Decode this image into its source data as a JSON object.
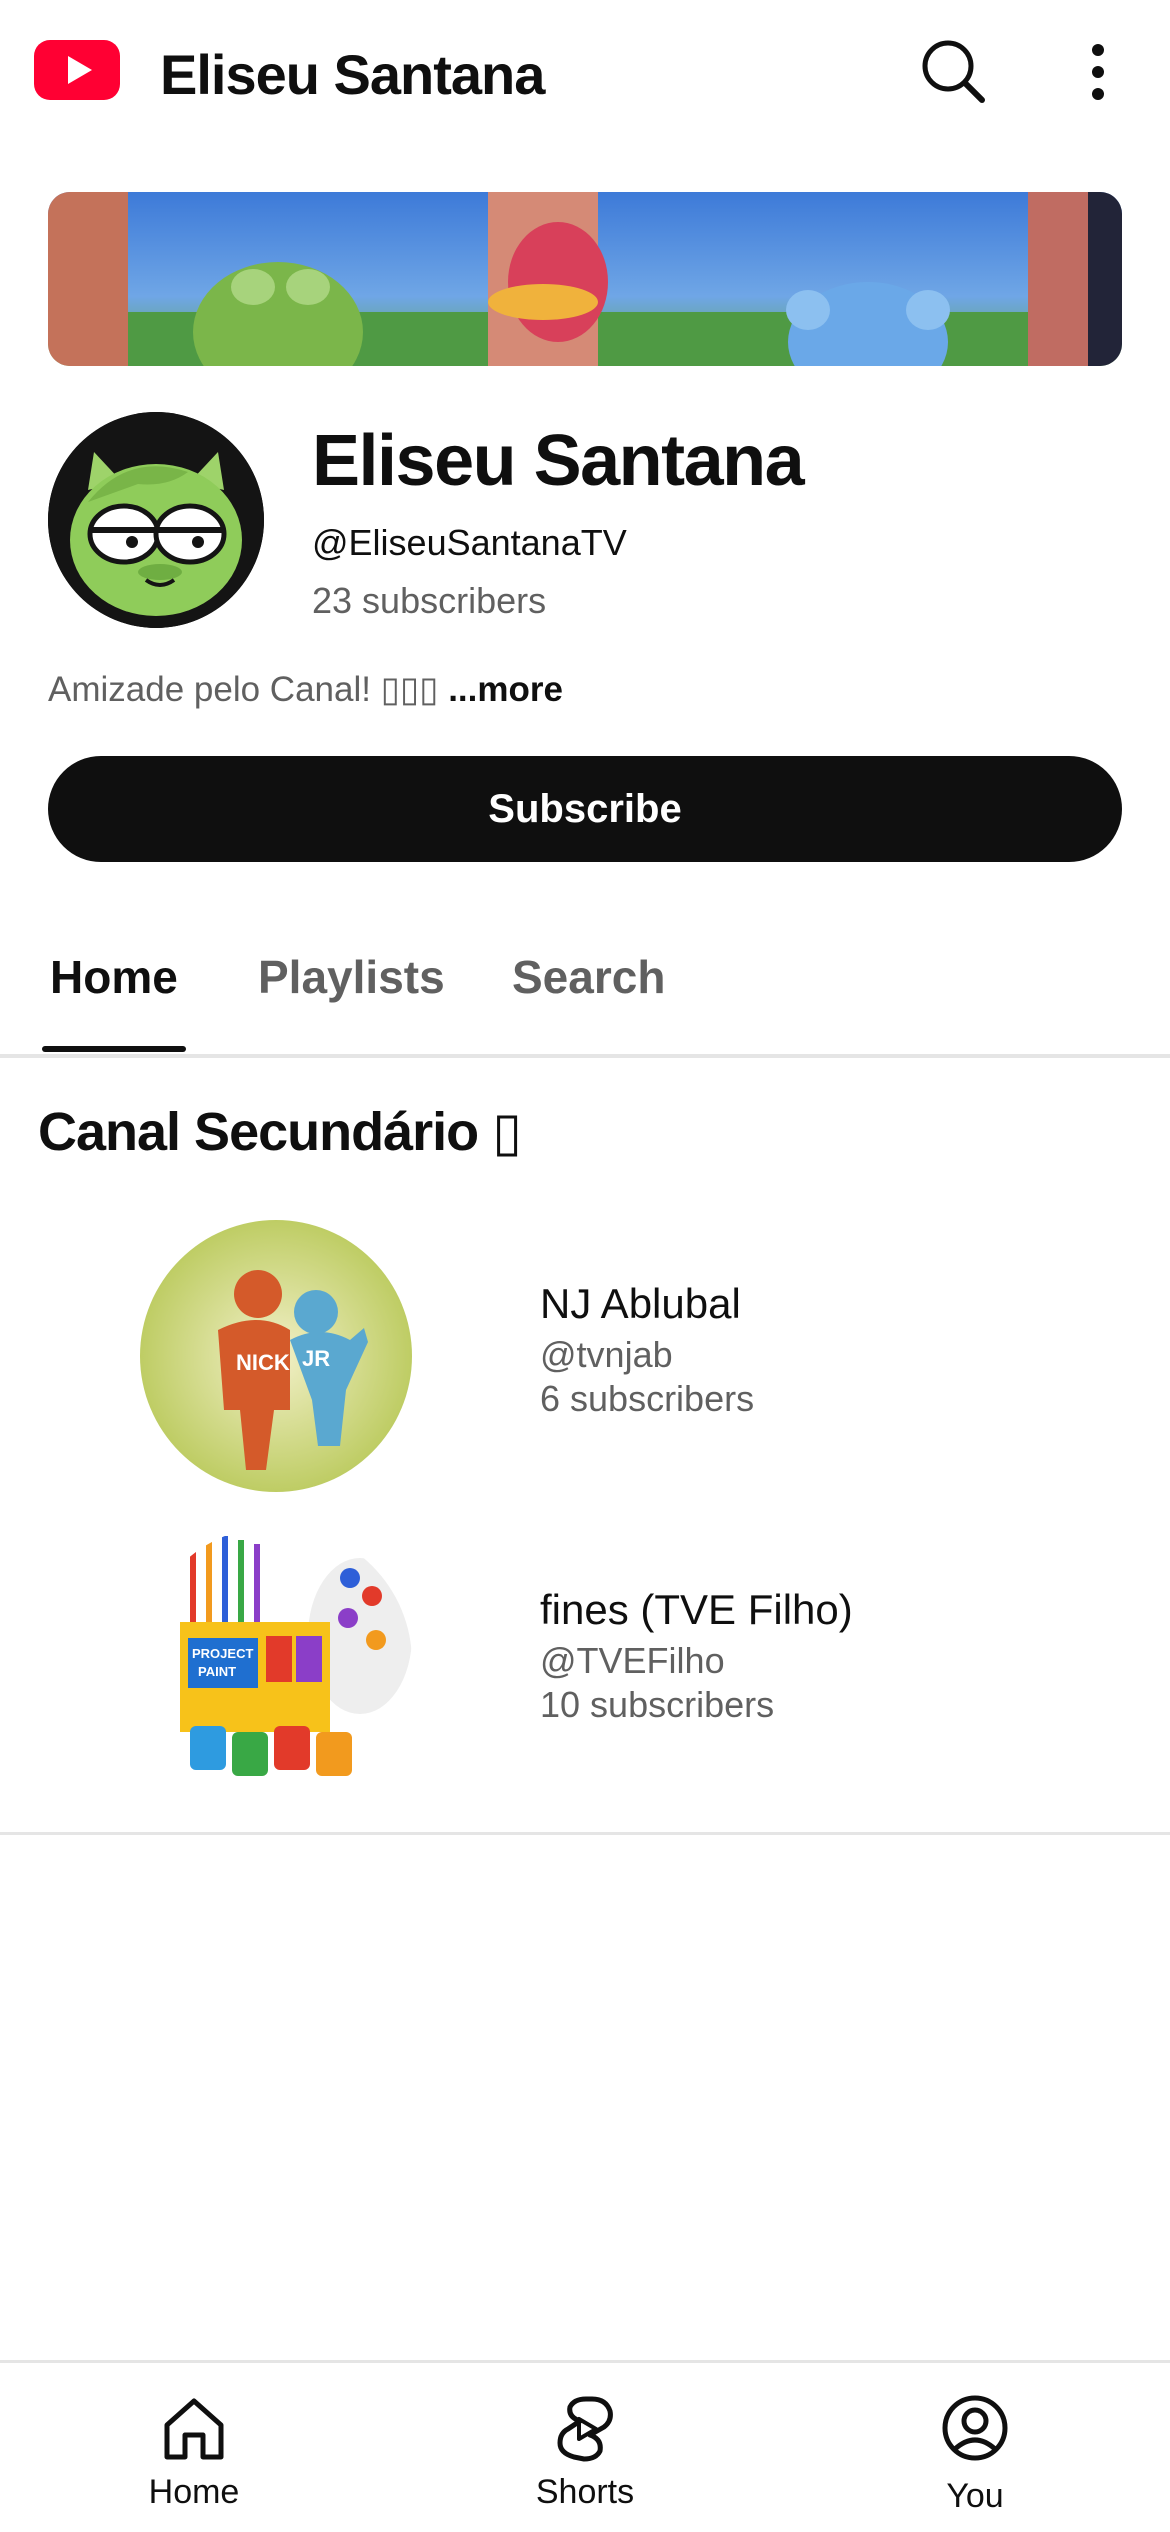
{
  "app": {
    "title": "Eliseu Santana"
  },
  "channel": {
    "name": "Eliseu Santana",
    "handle": "@EliseuSantanaTV",
    "subscribers": "23 subscribers",
    "description": "Amizade pelo Canal! ▯▯▯",
    "description_more": "...more",
    "subscribe_label": "Subscribe"
  },
  "tabs": [
    {
      "label": "Home",
      "active": true
    },
    {
      "label": "Playlists",
      "active": false
    },
    {
      "label": "Search",
      "active": false
    }
  ],
  "section": {
    "title": "Canal Secundário ▯",
    "channels": [
      {
        "name": "NJ Ablubal",
        "handle": "@tvnjab",
        "subscribers": "6 subscribers",
        "thumb_text": [
          "NICK",
          "JR"
        ]
      },
      {
        "name": "fines (TVE Filho)",
        "handle": "@TVEFilho",
        "subscribers": "10 subscribers",
        "thumb_text": [
          "PROJECT",
          "PAINT"
        ]
      }
    ]
  },
  "bottom_nav": [
    {
      "label": "Home",
      "icon": "home-icon"
    },
    {
      "label": "Shorts",
      "icon": "shorts-icon"
    },
    {
      "label": "You",
      "icon": "account-icon"
    }
  ],
  "colors": {
    "brand_red": "#ff0033",
    "text": "#0f0f0f",
    "secondary": "#606060"
  }
}
